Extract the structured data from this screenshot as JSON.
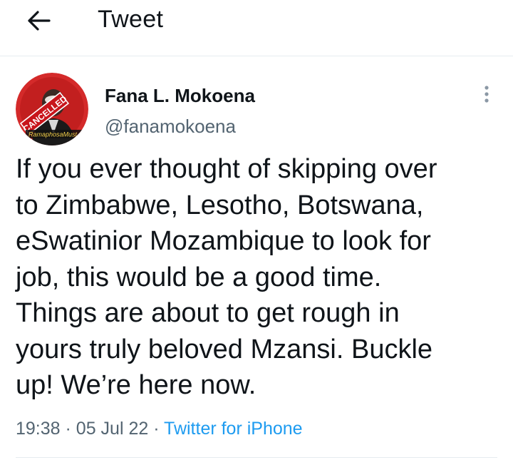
{
  "header": {
    "title": "Tweet",
    "back_icon": "arrow-left-icon"
  },
  "tweet": {
    "author": {
      "name": "Fana L. Mokoena",
      "handle": "@fanamokoena"
    },
    "avatar_overlay": {
      "banner": "CANCELLED",
      "caption": "RamaphosaMust"
    },
    "text": "If you ever thought of skipping over\nto Zimbabwe, Lesotho, Botswana,\neSwatinior Mozambique to look for\njob, this would be a good time.\nThings are about to get rough in\nyours truly beloved Mzansi. Buckle\nup! We’re here now.",
    "time": "19:38",
    "separator": "·",
    "date": "05 Jul 22",
    "source": "Twitter for iPhone"
  },
  "colors": {
    "accent": "#1d9bf0",
    "secondary_text": "#536471",
    "avatar_red": "#d42a2a",
    "divider": "#e6ecf0"
  },
  "icons": {
    "more": "more-vertical-icon"
  }
}
